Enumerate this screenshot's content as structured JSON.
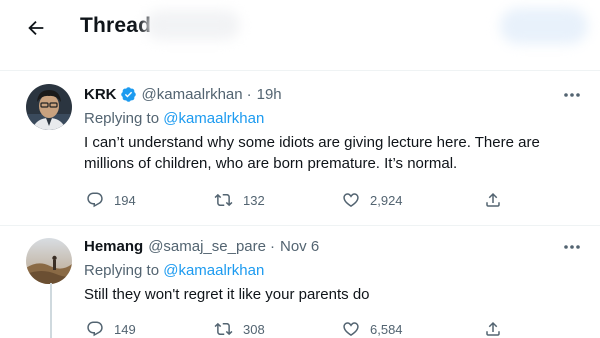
{
  "header": {
    "title": "Thread",
    "back_icon": "arrow-left-icon"
  },
  "tweets": [
    {
      "name": "KRK",
      "verified": true,
      "handle": "@kamaalrkhan",
      "separator": "·",
      "time": "19h",
      "reply_prefix": "Replying to ",
      "reply_to": "@kamaalrkhan",
      "text_line1": "I can’t understand why some idiots are giving lecture here. There are",
      "text_line2": "millions of children, who are born premature. It’s normal.",
      "replies": "194",
      "retweets": "132",
      "likes": "2,924"
    },
    {
      "name": "Hemang",
      "verified": false,
      "handle": "@samaj_se_pare",
      "separator": "·",
      "time": "Nov 6",
      "reply_prefix": "Replying to ",
      "reply_to": "@kamaalrkhan",
      "text_line1": "Still they won't regret it like your parents do",
      "replies": "149",
      "retweets": "308",
      "likes": "6,584"
    }
  ],
  "icons": {
    "reply": "reply-icon",
    "retweet": "retweet-icon",
    "like": "heart-icon",
    "share": "share-icon",
    "more": "more-icon",
    "verified": "verified-badge-icon"
  },
  "colors": {
    "accent": "#1d9bf0",
    "muted": "#536471",
    "text": "#0f1419",
    "divider": "#eff3f4"
  }
}
